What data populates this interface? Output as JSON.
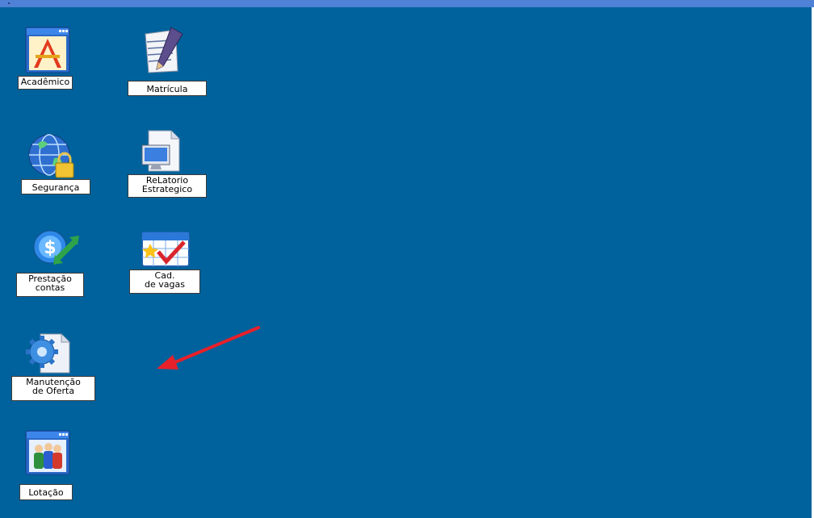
{
  "colors": {
    "desktop_background": "#00629c",
    "top_bar": "#4f82d6",
    "label_background": "#ffffff",
    "arrow": "#e8202a"
  },
  "desktop": {
    "shortcuts": [
      {
        "id": "academico",
        "lines": [
          "Acadêmico"
        ],
        "icon": "app-window-pencil-ruler-icon"
      },
      {
        "id": "matricula",
        "lines": [
          "Matrícula"
        ],
        "icon": "document-pen-icon"
      },
      {
        "id": "seguranca",
        "lines": [
          "Segurança"
        ],
        "icon": "globe-padlock-icon"
      },
      {
        "id": "relatorio",
        "lines": [
          "ReLatorio",
          "Estrategico"
        ],
        "icon": "document-monitor-icon"
      },
      {
        "id": "prestacao",
        "lines": [
          "Prestação",
          "contas"
        ],
        "icon": "dollar-globe-arrows-icon"
      },
      {
        "id": "cad_vagas",
        "lines": [
          "Cad.",
          "de vagas"
        ],
        "icon": "calendar-checkmark-icon"
      },
      {
        "id": "manutencao",
        "lines": [
          "Manutenção",
          "de Oferta"
        ],
        "icon": "document-gear-icon"
      },
      {
        "id": "lotacao",
        "lines": [
          "Lotação"
        ],
        "icon": "app-window-people-icon"
      }
    ]
  },
  "annotation": {
    "icon": "red-arrow-icon"
  }
}
